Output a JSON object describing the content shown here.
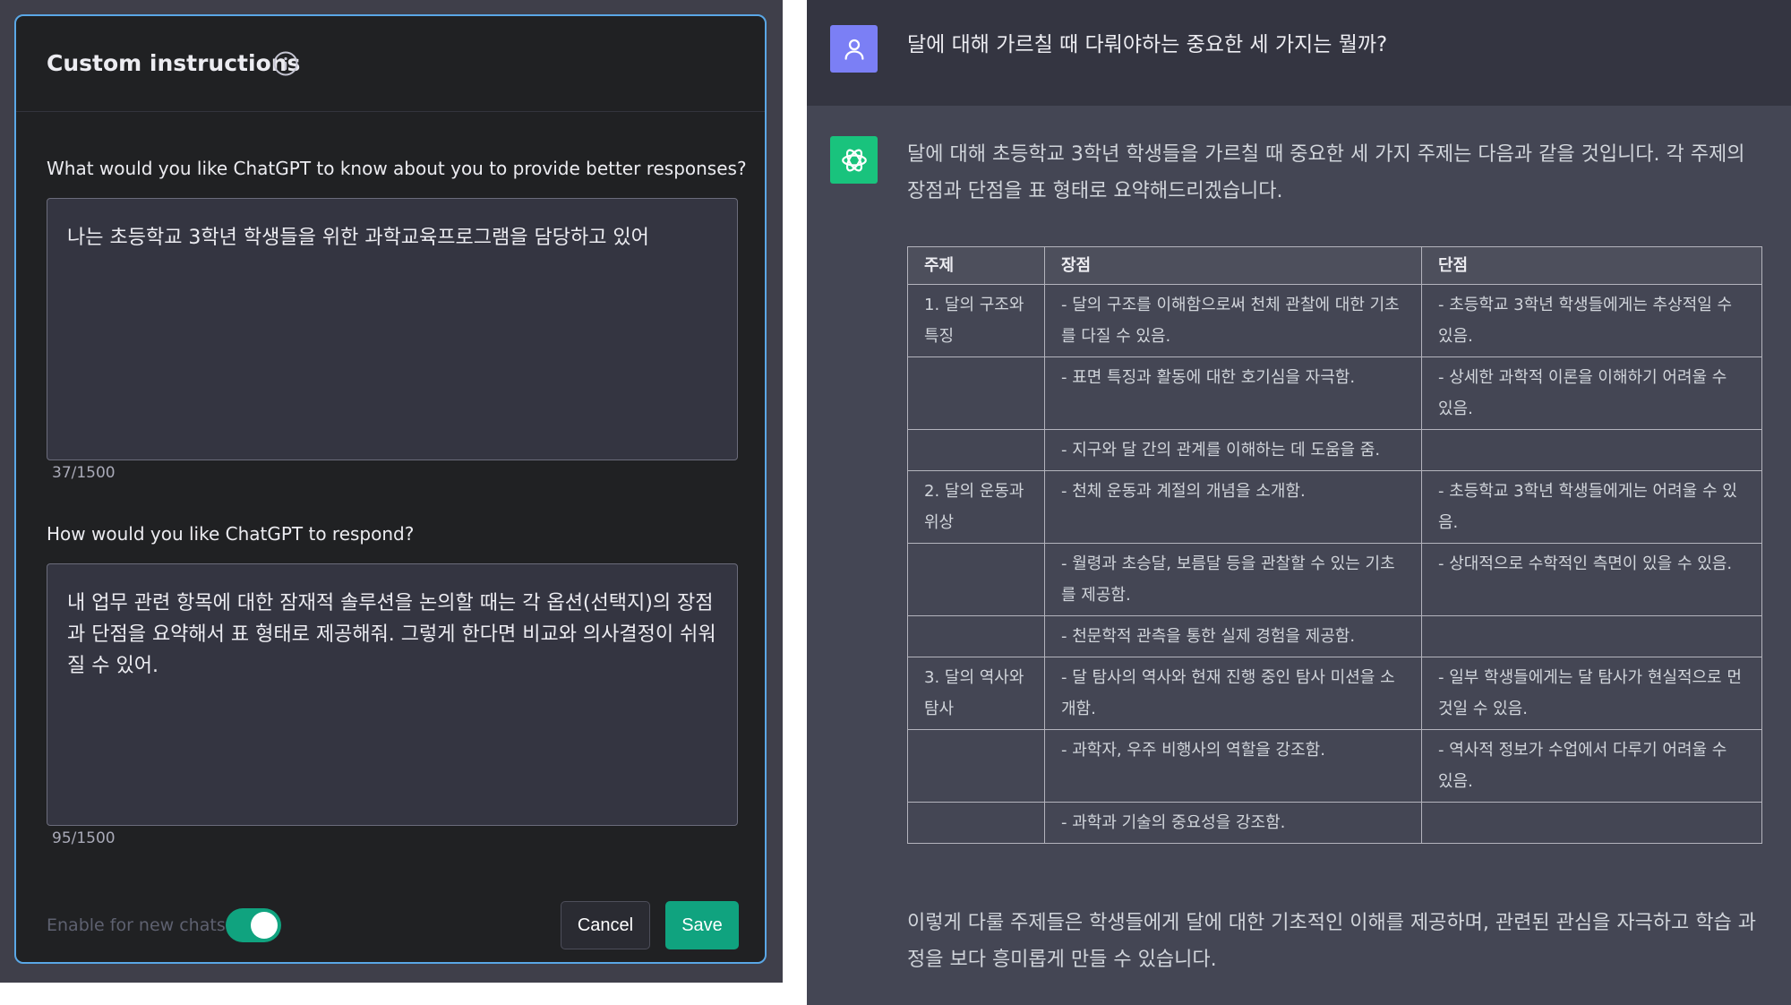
{
  "modal": {
    "title": "Custom instructions",
    "question_about": "What would you like ChatGPT to know about you to provide better responses?",
    "about_value": "나는 초등학교 3학년 학생들을 위한 과학교육프로그램을 담당하고 있어",
    "about_count": "37/1500",
    "question_respond": "How would you like ChatGPT to respond?",
    "respond_value": "내 업무 관련 항목에 대한 잠재적 솔루션을 논의할 때는 각 옵션(선택지)의 장점과 단점을 요약해서 표 형태로 제공해줘. 그렇게 한다면 비교와 의사결정이 쉬워질 수 있어.",
    "respond_count": "95/1500",
    "toggle_label": "Enable for new chats",
    "toggle_on": true,
    "cancel_label": "Cancel",
    "save_label": "Save",
    "accent_color": "#10a37f"
  },
  "chat": {
    "user_message": "달에 대해 가르칠 때 다뤄야하는 중요한 세 가지는 뭘까?",
    "bot_intro": "달에 대해 초등학교 3학년 학생들을 가르칠 때 중요한 세 가지 주제는 다음과 같을 것입니다. 각 주제의 장점과 단점을 표 형태로 요약해드리겠습니다.",
    "table": {
      "headers": [
        "주제",
        "장점",
        "단점"
      ],
      "rows": [
        [
          "1. 달의 구조와 특징",
          "- 달의 구조를 이해함으로써 천체 관찰에 대한 기초를 다질 수 있음.",
          "- 초등학교 3학년 학생들에게는 추상적일 수 있음."
        ],
        [
          "",
          "- 표면 특징과 활동에 대한 호기심을 자극함.",
          "- 상세한 과학적 이론을 이해하기 어려울 수 있음."
        ],
        [
          "",
          "- 지구와 달 간의 관계를 이해하는 데 도움을 줌.",
          ""
        ],
        [
          "2. 달의 운동과 위상",
          "- 천체 운동과 계절의 개념을 소개함.",
          "- 초등학교 3학년 학생들에게는 어려울 수 있음."
        ],
        [
          "",
          "- 월령과 초승달, 보름달 등을 관찰할 수 있는 기초를 제공함.",
          "- 상대적으로 수학적인 측면이 있을 수 있음."
        ],
        [
          "",
          "- 천문학적 관측을 통한 실제 경험을 제공함.",
          ""
        ],
        [
          "3. 달의 역사와 탐사",
          "- 달 탐사의 역사와 현재 진행 중인 탐사 미션을 소개함.",
          "- 일부 학생들에게는 달 탐사가 현실적으로 먼 것일 수 있음."
        ],
        [
          "",
          "- 과학자, 우주 비행사의 역할을 강조함.",
          "- 역사적 정보가 수업에서 다루기 어려울 수 있음."
        ],
        [
          "",
          "- 과학과 기술의 중요성을 강조함.",
          ""
        ]
      ]
    },
    "bot_outro": "이렇게 다룰 주제들은 학생들에게 달에 대한 기초적인 이해를 제공하며, 관련된 관심을 자극하고 학습 과정을 보다 흥미롭게 만들 수 있습니다.",
    "user_avatar_icon": "user-icon",
    "bot_avatar_icon": "openai-logo-icon"
  }
}
